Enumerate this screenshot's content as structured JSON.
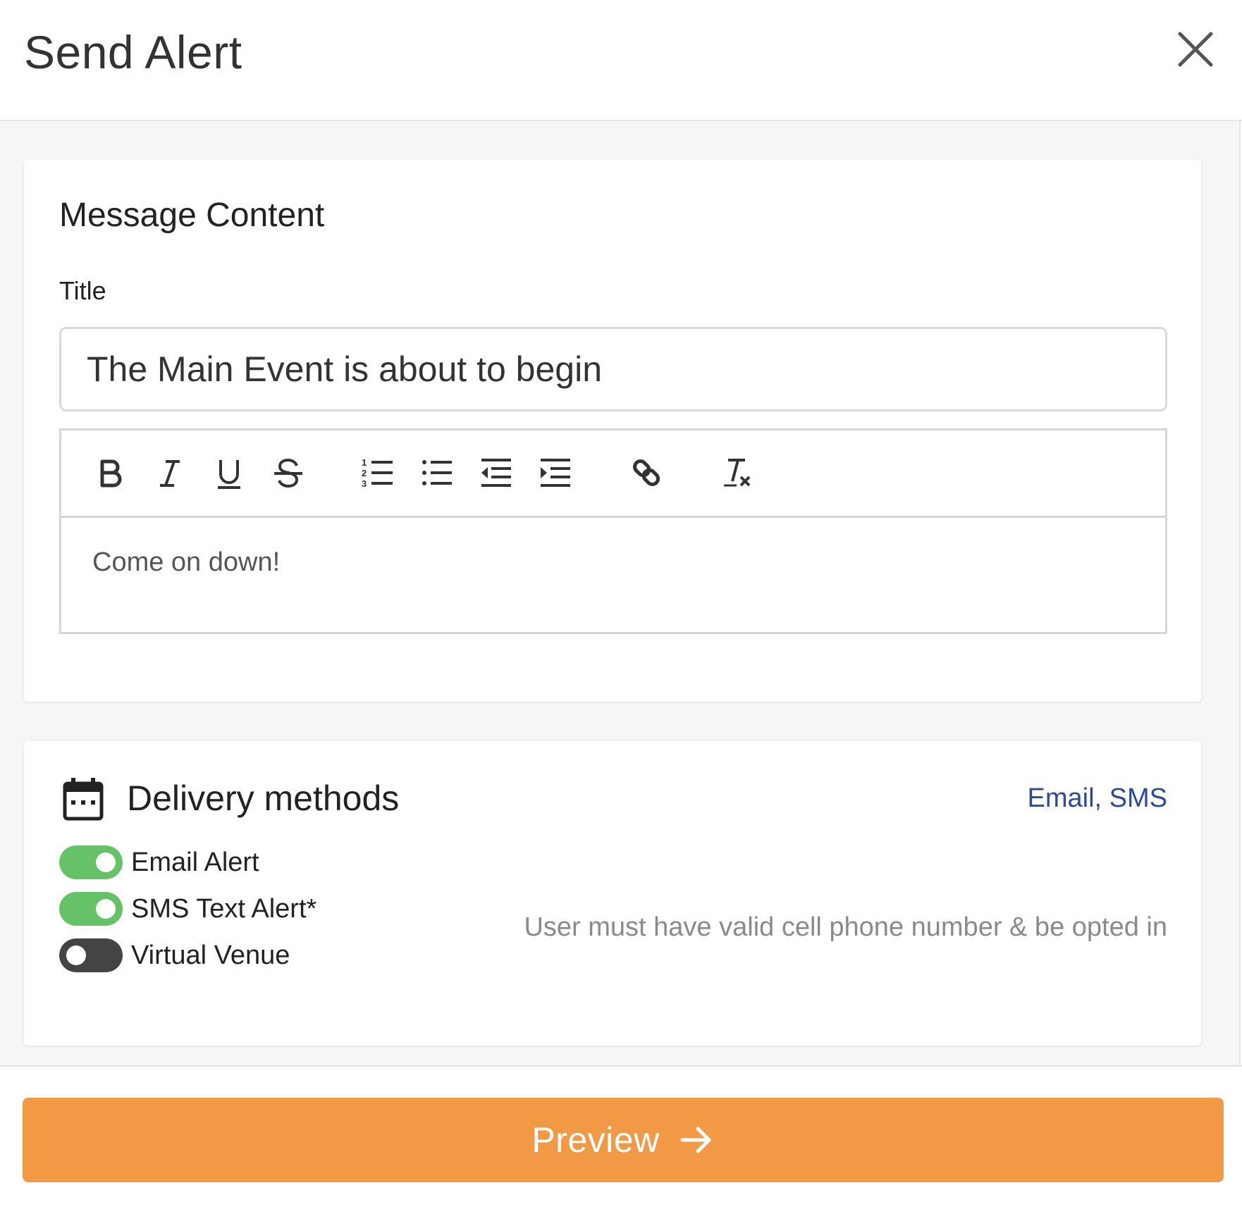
{
  "header": {
    "title": "Send Alert",
    "close_icon": "close-icon"
  },
  "message_content": {
    "section_title": "Message Content",
    "title_label": "Title",
    "title_value": "The Main Event is about to begin",
    "toolbar": [
      "bold-icon",
      "italic-icon",
      "underline-icon",
      "strikethrough-icon",
      "ordered-list-icon",
      "bullet-list-icon",
      "outdent-icon",
      "indent-icon",
      "link-icon",
      "clear-format-icon"
    ],
    "body_text": "Come on down!"
  },
  "delivery": {
    "icon": "calendar-icon",
    "section_title": "Delivery methods",
    "summary": "Email, SMS",
    "toggles": [
      {
        "label": "Email Alert",
        "on": true
      },
      {
        "label": "SMS Text Alert*",
        "on": true
      },
      {
        "label": "Virtual Venue",
        "on": false
      }
    ],
    "sms_note": "User must have valid cell phone number & be opted in"
  },
  "footer": {
    "preview_label": "Preview",
    "arrow_icon": "arrow-right-icon"
  },
  "colors": {
    "accent_orange": "#f19944",
    "toggle_on": "#66c266",
    "toggle_off": "#444444",
    "link_blue": "#2d4a9a"
  }
}
